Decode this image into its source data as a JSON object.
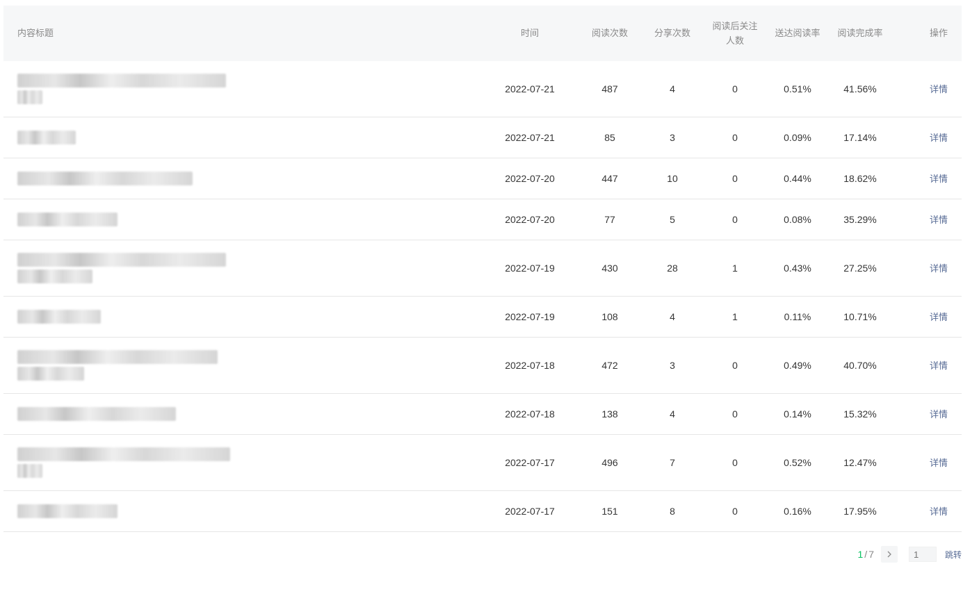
{
  "headers": {
    "title": "内容标题",
    "time": "时间",
    "reads": "阅读次数",
    "shares": "分享次数",
    "follows_line1": "阅读后关注",
    "follows_line2": "人数",
    "delivery_rate": "送达阅读率",
    "completion_rate": "阅读完成率",
    "action": "操作"
  },
  "rows": [
    {
      "date": "2022-07-21",
      "reads": "487",
      "shares": "4",
      "follows": "0",
      "delivery_rate": "0.51%",
      "completion_rate": "41.56%",
      "action": "详情"
    },
    {
      "date": "2022-07-21",
      "reads": "85",
      "shares": "3",
      "follows": "0",
      "delivery_rate": "0.09%",
      "completion_rate": "17.14%",
      "action": "详情"
    },
    {
      "date": "2022-07-20",
      "reads": "447",
      "shares": "10",
      "follows": "0",
      "delivery_rate": "0.44%",
      "completion_rate": "18.62%",
      "action": "详情"
    },
    {
      "date": "2022-07-20",
      "reads": "77",
      "shares": "5",
      "follows": "0",
      "delivery_rate": "0.08%",
      "completion_rate": "35.29%",
      "action": "详情"
    },
    {
      "date": "2022-07-19",
      "reads": "430",
      "shares": "28",
      "follows": "1",
      "delivery_rate": "0.43%",
      "completion_rate": "27.25%",
      "action": "详情"
    },
    {
      "date": "2022-07-19",
      "reads": "108",
      "shares": "4",
      "follows": "1",
      "delivery_rate": "0.11%",
      "completion_rate": "10.71%",
      "action": "详情"
    },
    {
      "date": "2022-07-18",
      "reads": "472",
      "shares": "3",
      "follows": "0",
      "delivery_rate": "0.49%",
      "completion_rate": "40.70%",
      "action": "详情"
    },
    {
      "date": "2022-07-18",
      "reads": "138",
      "shares": "4",
      "follows": "0",
      "delivery_rate": "0.14%",
      "completion_rate": "15.32%",
      "action": "详情"
    },
    {
      "date": "2022-07-17",
      "reads": "496",
      "shares": "7",
      "follows": "0",
      "delivery_rate": "0.52%",
      "completion_rate": "12.47%",
      "action": "详情"
    },
    {
      "date": "2022-07-17",
      "reads": "151",
      "shares": "8",
      "follows": "0",
      "delivery_rate": "0.16%",
      "completion_rate": "17.95%",
      "action": "详情"
    }
  ],
  "pagination": {
    "current": "1",
    "separator": "/",
    "total": "7",
    "next_icon": "chevron-right-icon",
    "input_placeholder": "1",
    "jump_label": "跳转"
  },
  "colors": {
    "link": "#576b95",
    "accent": "#07c160",
    "header_bg": "#f6f7f8"
  }
}
